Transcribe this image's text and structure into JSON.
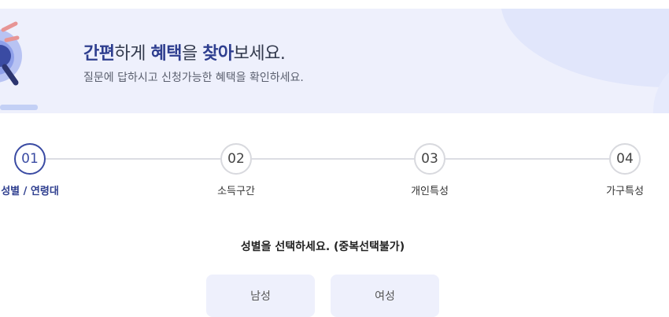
{
  "banner": {
    "title_parts": [
      "간편",
      "하게 ",
      "혜택",
      "을 ",
      "찾아",
      "보세요."
    ],
    "subtitle": "질문에 답하시고 신청가능한 혜택을 확인하세요."
  },
  "steps": [
    {
      "number": "01",
      "label": "성별 / 연령대",
      "active": true
    },
    {
      "number": "02",
      "label": "소득구간",
      "active": false
    },
    {
      "number": "03",
      "label": "개인특성",
      "active": false
    },
    {
      "number": "04",
      "label": "가구특성",
      "active": false
    }
  ],
  "question": {
    "text": "성별을 선택하세요. (중복선택불가)"
  },
  "options": [
    "남성",
    "여성"
  ],
  "colors": {
    "accent": "#3a4ba3",
    "banner_bg": "#eef0fc",
    "option_bg": "#eef0fc"
  },
  "icons": {
    "illustration": "magnifier-illustration"
  }
}
